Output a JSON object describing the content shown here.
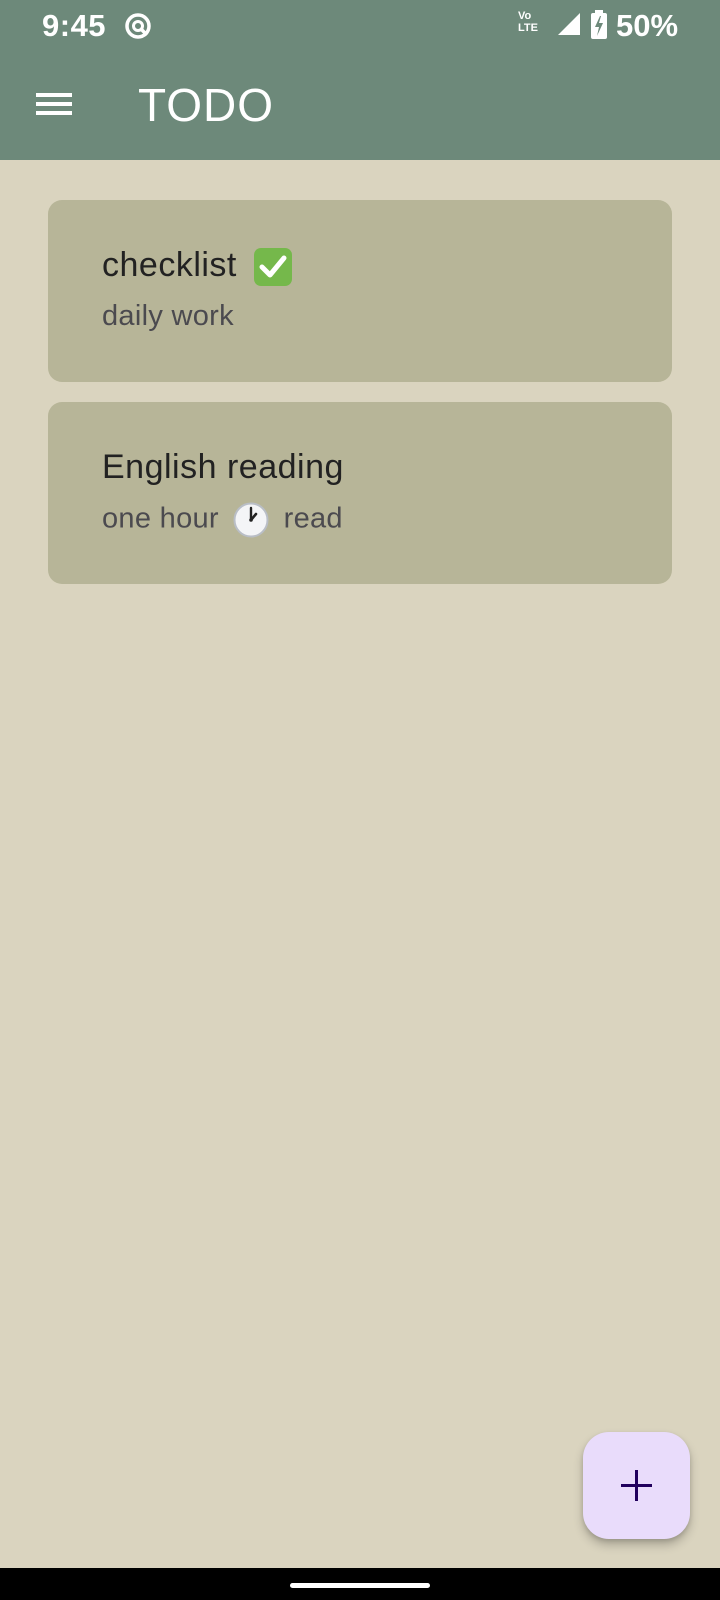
{
  "status_bar": {
    "time": "9:45",
    "network_label_top": "Vo",
    "network_label_bottom": "LTE",
    "battery": "50%"
  },
  "app_bar": {
    "title": "TODO"
  },
  "todos": [
    {
      "title": "checklist",
      "title_emoji": "check-mark-icon",
      "subtitle": "daily work"
    },
    {
      "title": "English reading",
      "subtitle_prefix": "one hour",
      "subtitle_emoji": "clock-icon",
      "subtitle_suffix": "read"
    }
  ],
  "colors": {
    "app_bar": "#6d897a",
    "background": "#dad4bf",
    "card": "#b7b598",
    "fab": "#e9dcfb",
    "fab_icon": "#21005d"
  }
}
